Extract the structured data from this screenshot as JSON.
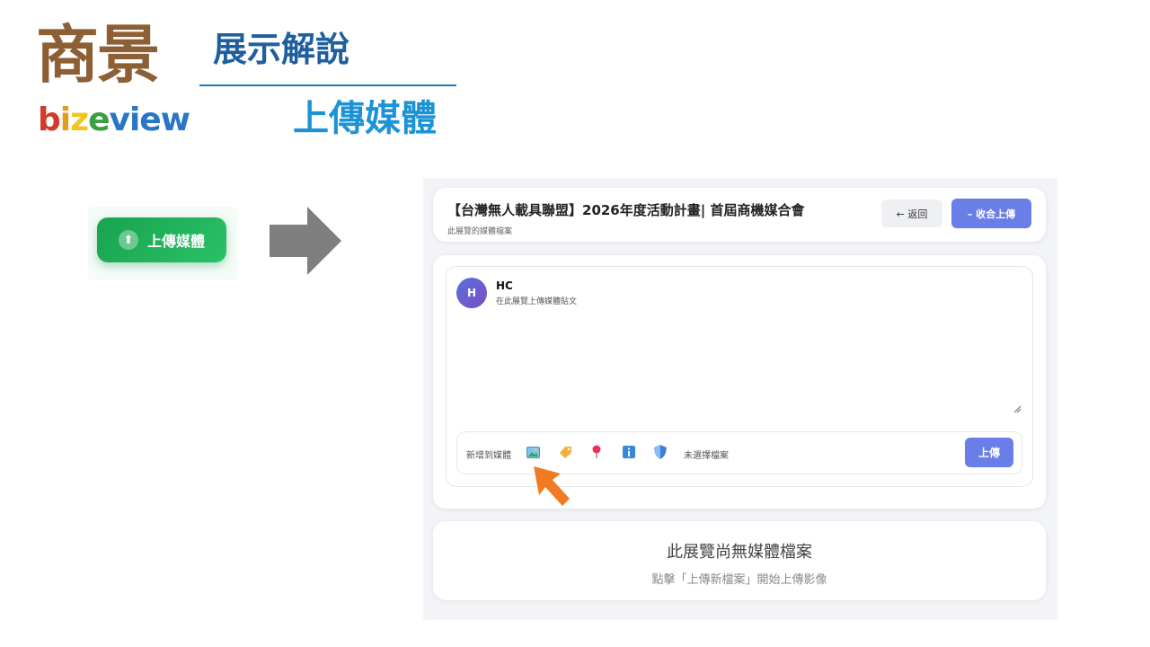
{
  "slide": {
    "logo_chinese": "商景",
    "logo_english": {
      "b": "b",
      "i": "i",
      "z": "z",
      "e": "e",
      "view": "view"
    },
    "title": "展示解說",
    "subtitle": "上傳媒體"
  },
  "demo_button": {
    "label": "上傳媒體",
    "icon": "arrow-up-circle-icon"
  },
  "panel": {
    "header": {
      "title": "【台灣無人載具聯盟】2026年度活動計畫| 首屆商機媒合會",
      "subtitle": "此展覽的媒體檔案",
      "back_label": "← 返回",
      "collapse_label": "– 收合上傳"
    },
    "composer": {
      "avatar_initial": "H",
      "user_name": "HC",
      "hint": "在此展覽上傳媒體貼文"
    },
    "toolbar": {
      "add_label": "新增到媒體",
      "icons": [
        "image-icon",
        "tag-icon",
        "location-pin-icon",
        "info-icon",
        "shield-icon"
      ],
      "file_status": "未選擇檔案",
      "upload_label": "上傳"
    },
    "empty_state": {
      "title": "此展覽尚無媒體檔案",
      "hint": "點擊「上傳新檔案」開始上傳影像"
    }
  },
  "colors": {
    "logo_brown": "#8d5f34",
    "title_blue": "#1f5f9e",
    "subtitle_blue": "#1b93d6",
    "green_button": "#22b35c",
    "primary_button": "#6a7ee8",
    "pointer_orange": "#ef7b22",
    "big_arrow_grey": "#7f7f7f"
  }
}
